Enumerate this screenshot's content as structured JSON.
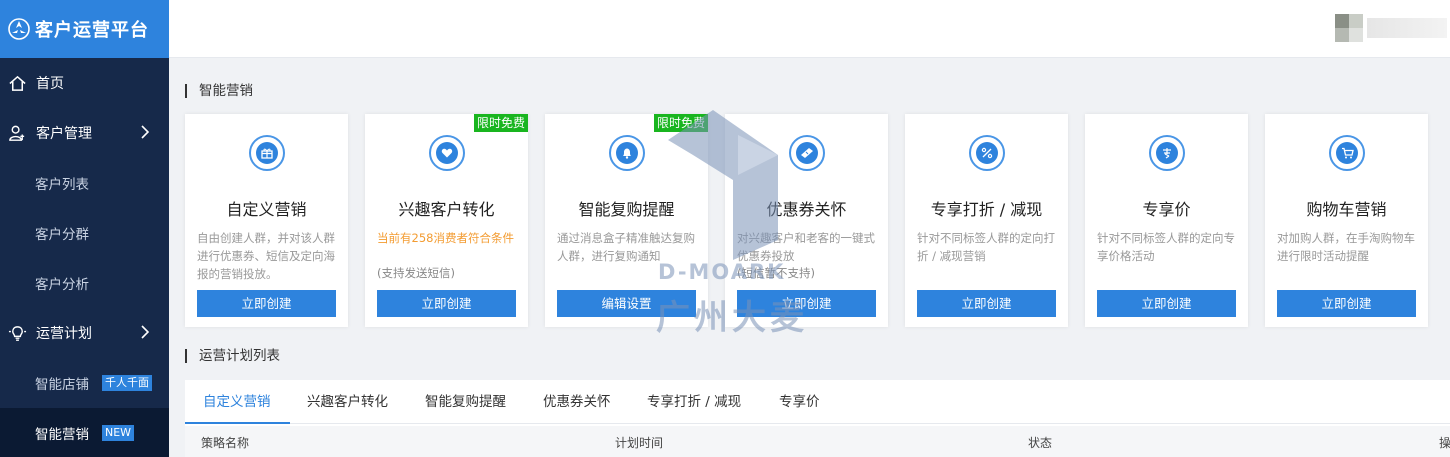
{
  "brand": {
    "title": "客户运营平台"
  },
  "sidebar": {
    "items": [
      {
        "label": "首页"
      },
      {
        "label": "客户管理"
      },
      {
        "label": "客户列表"
      },
      {
        "label": "客户分群"
      },
      {
        "label": "客户分析"
      },
      {
        "label": "运营计划"
      },
      {
        "label": "智能店铺",
        "badge": "千人千面"
      },
      {
        "label": "智能营销",
        "badge": "NEW"
      }
    ]
  },
  "main": {
    "section1_title": "智能营销",
    "section2_title": "运营计划列表",
    "cards": [
      {
        "title": "自定义营销",
        "desc": "自由创建人群，并对该人群进行优惠券、短信及定向海报的营销投放。",
        "button": "立即创建"
      },
      {
        "title": "兴趣客户转化",
        "desc": "当前有258消费者符合条件",
        "desc2": "(支持发送短信)",
        "button": "立即创建",
        "tag": "限时免费"
      },
      {
        "title": "智能复购提醒",
        "desc": "通过消息盒子精准触达复购人群，进行复购通知",
        "button": "编辑设置",
        "tag": "限时免费"
      },
      {
        "title": "优惠券关怀",
        "desc": "对兴趣客户和老客的一键式优惠券投放",
        "desc2": "(短信暂不支持)",
        "button": "立即创建"
      },
      {
        "title": "专享打折 / 减现",
        "desc": "针对不同标签人群的定向打折 / 减现营销",
        "button": "立即创建"
      },
      {
        "title": "专享价",
        "desc": "针对不同标签人群的定向专享价格活动",
        "button": "立即创建"
      },
      {
        "title": "购物车营销",
        "desc": "对加购人群，在手淘购物车进行限时活动提醒",
        "button": "立即创建"
      }
    ],
    "tabs": [
      "自定义营销",
      "兴趣客户转化",
      "智能复购提醒",
      "优惠券关怀",
      "专享打折 / 减现",
      "专享价"
    ],
    "table_headers": [
      "策略名称",
      "计划时间",
      "状态",
      "操"
    ]
  },
  "watermark": {
    "en": "D-MOARK",
    "cn": "广州大麦"
  },
  "colors": {
    "primary": "#2e83dd",
    "sidebar": "#16294a",
    "tag": "#19b51f",
    "highlight": "#f39c32"
  }
}
